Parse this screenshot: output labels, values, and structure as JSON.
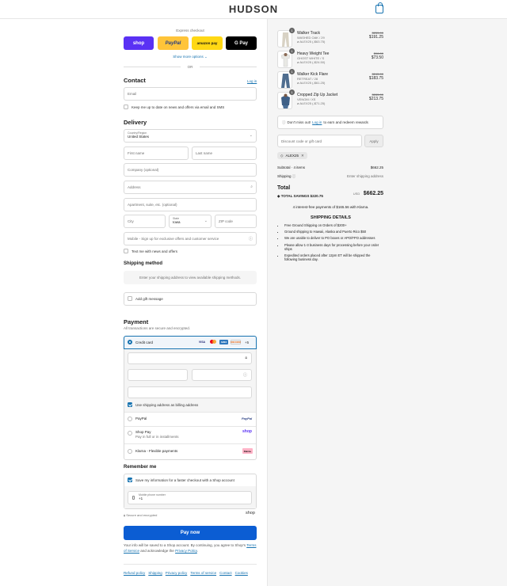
{
  "header": {
    "brand": "HUDSON"
  },
  "express": {
    "title": "Express checkout",
    "shop": "shop",
    "paypal": "PayPal",
    "amazon": "amazon pay",
    "gpay": "G Pay",
    "show_more": "Show more options",
    "or": "OR"
  },
  "contact": {
    "title": "Contact",
    "login": "Log in",
    "email_placeholder": "Email",
    "news_label": "Keep me up to date on news and offers via email and SMS"
  },
  "delivery": {
    "title": "Delivery",
    "country_label": "Country/Region",
    "country_value": "United States",
    "first_name": "First name",
    "last_name": "Last name",
    "company": "Company (optional)",
    "address": "Address",
    "apartment": "Apartment, suite, etc. (optional)",
    "city": "City",
    "state_label": "State",
    "state_value": "Iowa",
    "zip": "ZIP code",
    "mobile": "Mobile - Sign up for exclusive offers and customer service",
    "text_me": "Text me with news and offers"
  },
  "shipping_method": {
    "title": "Shipping method",
    "message": "Enter your shipping address to view available shipping methods."
  },
  "gift": {
    "label": "Add gift message"
  },
  "payment": {
    "title": "Payment",
    "subtitle": "All transactions are secure and encrypted.",
    "credit_card": "Credit card",
    "card_more": "+5",
    "use_shipping": "Use shipping address as billing address",
    "paypal": "PayPal",
    "shop_pay": "Shop Pay",
    "shop_pay_sub": "Pay in full or in installments",
    "klarna": "Klarna - Flexible payments",
    "visa": "VISA",
    "amex": "AMEX",
    "discover": "DISCOVER",
    "paypal_badge": "PayPal",
    "shop_badge": "shop",
    "klarna_badge": "Klarna."
  },
  "remember": {
    "title": "Remember me",
    "save_label": "Save my information for a faster checkout with a Shop account",
    "phone_label": "Mobile phone number",
    "phone_value": "+1",
    "secure": "Secure and encrypted",
    "shop": "shop"
  },
  "pay_button": "Pay now",
  "terms": {
    "text1": "Your info will be saved to a Shop account. By continuing, you agree to Shop's",
    "terms": "Terms of Service",
    "text2": "and acknowledge the",
    "privacy": "Privacy Policy",
    "end": "."
  },
  "footer": [
    "Refund policy",
    "Shipping",
    "Privacy policy",
    "Terms of service",
    "Contact",
    "Cookies"
  ],
  "cart": {
    "items": [
      {
        "qty": "1",
        "name": "Walker Track",
        "variant": "WASHED OAK / 29",
        "discount": "ALEX25 (-$63.75)",
        "old": "$255.00",
        "new": "$191.25"
      },
      {
        "qty": "1",
        "name": "Heavy Weight Tee",
        "variant": "GHOST WHITE / S",
        "discount": "ALEX25 (-$24.50)",
        "old": "$98.00",
        "new": "$73.50"
      },
      {
        "qty": "1",
        "name": "Walker Kick Flare",
        "variant": "RETREAT / 28",
        "discount": "ALEX25 (-$61.25)",
        "old": "$245.00",
        "new": "$183.75"
      },
      {
        "qty": "1",
        "name": "Cropped Zip Up Jacket",
        "variant": "VENOM / XS",
        "discount": "ALEX25 (-$71.25)",
        "old": "$285.00",
        "new": "$213.75"
      }
    ],
    "rewards_pre": "Don't miss out!",
    "rewards_link": "Log in",
    "rewards_post": "to earn and redeem rewards",
    "discount_placeholder": "Discount code or gift card",
    "apply": "Apply",
    "code": "ALEX25",
    "subtotal_label": "Subtotal · 4 items",
    "subtotal": "$662.25",
    "shipping_label": "Shipping",
    "shipping_value": "Enter shipping address",
    "total_label": "Total",
    "currency": "USD",
    "total": "$662.25",
    "savings_label": "TOTAL SAVINGS",
    "savings": "$220.75",
    "klarna": "4 interest-free payments of $165.56 with Klarna.",
    "ship_title": "SHIPPING DETAILS",
    "ship_items": [
      "Free Ground Shipping on Orders of $200+",
      "Ground shipping to Hawaii, Alaska and Puerto Rico $50",
      "We are unable to deliver to PO boxes or APO/FPO addresses",
      "Please allow 1-3 business days for processing before your order ships",
      "Expedited orders placed after 12pm ET will be shipped the following business day."
    ]
  },
  "colors": {
    "accent": "#1773b0",
    "shop": "#5a31f4",
    "paypal": "#ffc439",
    "amazon": "#ffd814",
    "pay_button": "#0b5dd3"
  }
}
